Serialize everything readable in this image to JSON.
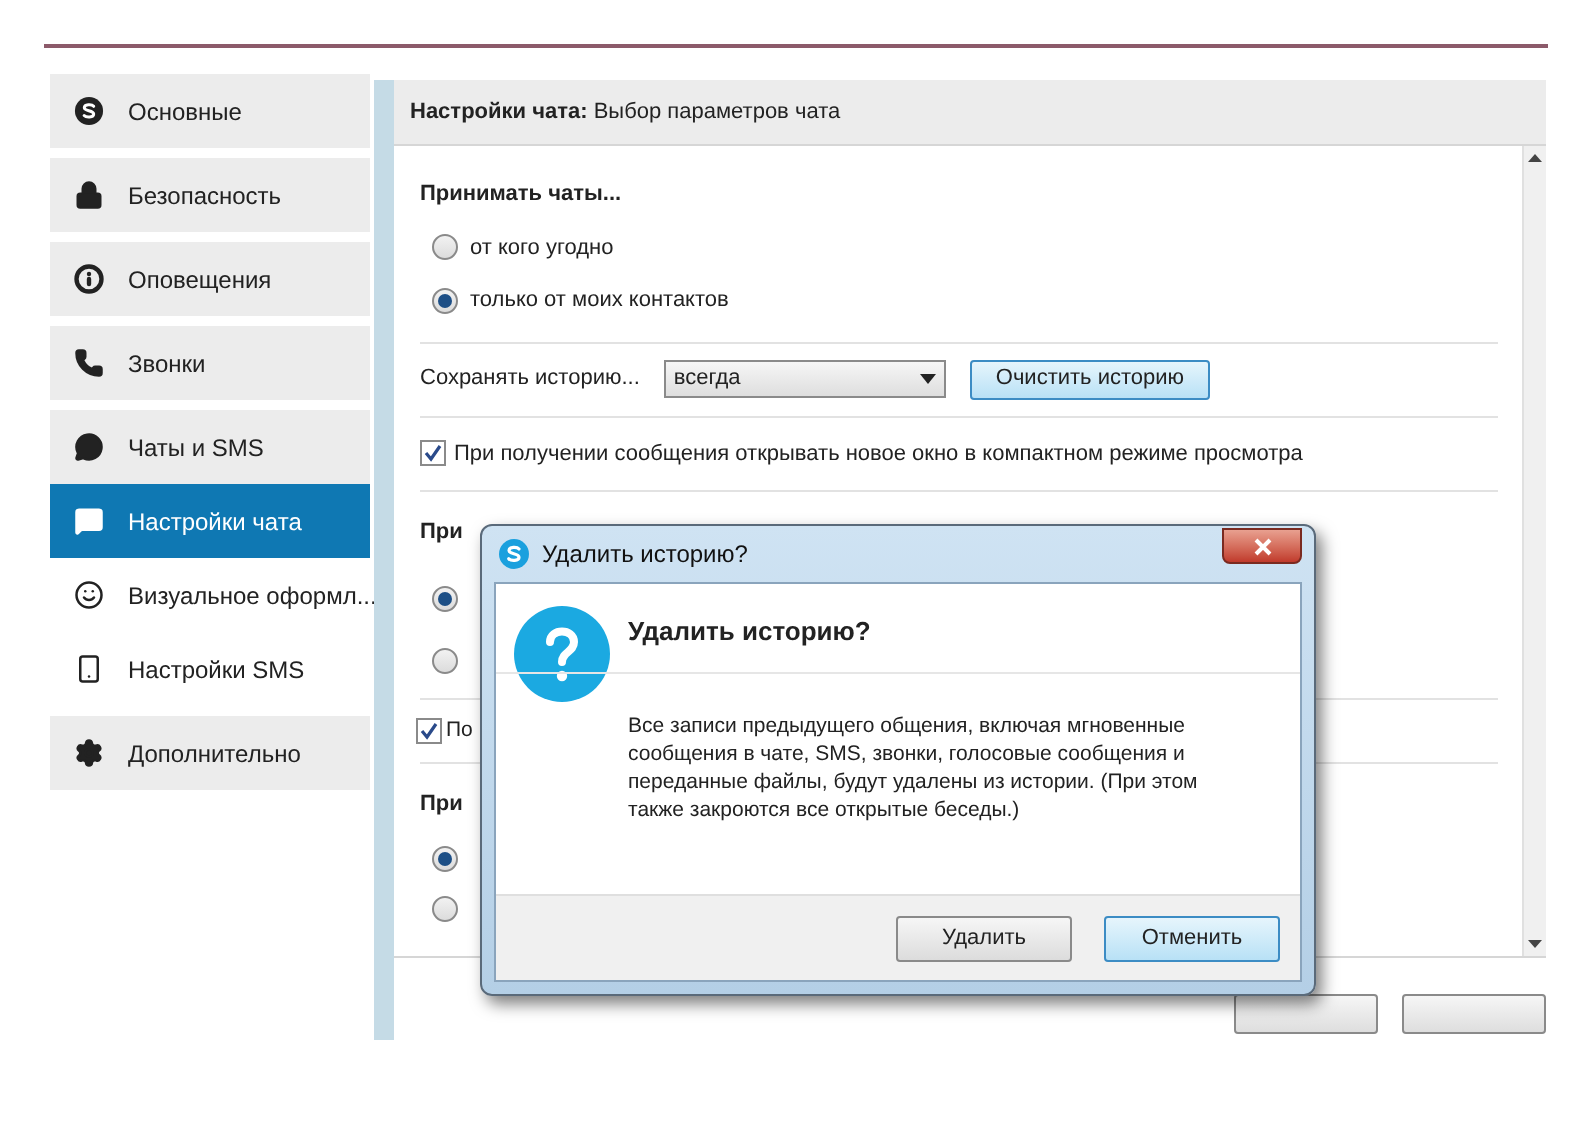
{
  "sidebar": {
    "items": [
      {
        "label": "Основные",
        "selected": false
      },
      {
        "label": "Безопасность",
        "selected": false
      },
      {
        "label": "Оповещения",
        "selected": false
      },
      {
        "label": "Звонки",
        "selected": false
      },
      {
        "label": "Чаты и SMS",
        "selected": false,
        "children": [
          {
            "label": "Настройки чата",
            "selected": true
          },
          {
            "label": "Визуальное оформл...",
            "selected": false
          },
          {
            "label": "Настройки SMS",
            "selected": false
          }
        ]
      },
      {
        "label": "Дополнительно",
        "selected": false
      }
    ]
  },
  "header": {
    "title": "Настройки чата:",
    "subtitle": "Выбор параметров чата"
  },
  "accept_chats": {
    "heading": "Принимать чаты...",
    "options": [
      {
        "label": "от кого угодно",
        "selected": false
      },
      {
        "label": "только от моих контактов",
        "selected": true
      }
    ]
  },
  "history": {
    "label": "Сохранять историю...",
    "value": "всегда",
    "button": "Очистить историю"
  },
  "compact_window": {
    "label": "При получении сообщения открывать новое окно в компактном режиме просмотра",
    "checked": true
  },
  "section_3": {
    "heading": "При",
    "options": [
      {
        "selected": true
      },
      {
        "selected": false
      }
    ]
  },
  "checkbox_2": {
    "label": "По",
    "checked": true
  },
  "section_4": {
    "heading": "При",
    "options": [
      {
        "selected": true
      },
      {
        "selected": false
      }
    ]
  },
  "dialog": {
    "title": "Удалить историю?",
    "heading": "Удалить историю?",
    "message": "Все записи предыдущего общения, включая мгновенные сообщения в чате, SMS, звонки, голосовые сообщения и переданные файлы, будут удалены из истории. (При этом также закроются все открытые беседы.)",
    "buttons": [
      {
        "label": "Удалить",
        "default": false
      },
      {
        "label": "Отменить",
        "default": true
      }
    ]
  }
}
